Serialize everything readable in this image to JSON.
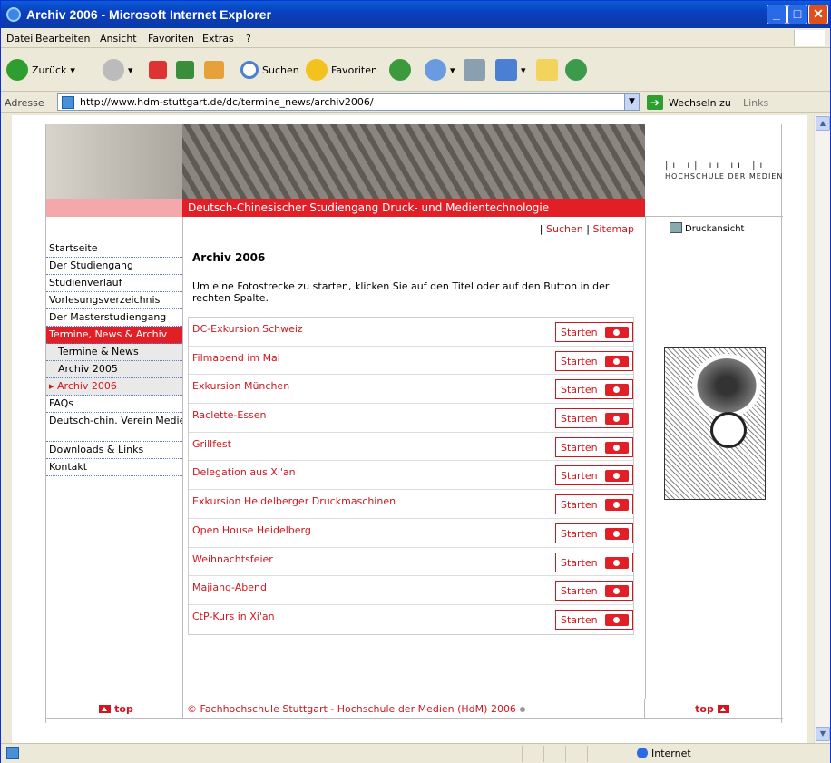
{
  "window": {
    "title": "Archiv 2006 - Microsoft Internet Explorer"
  },
  "menu": [
    "Datei",
    "Bearbeiten",
    "Ansicht",
    "Favoriten",
    "Extras",
    "?"
  ],
  "toolbar": {
    "back": "Zurück",
    "search": "Suchen",
    "favorites": "Favoriten"
  },
  "address": {
    "label": "Adresse",
    "url": "http://www.hdm-stuttgart.de/dc/termine_news/archiv2006/",
    "go": "Wechseln zu",
    "links": "Links"
  },
  "site": {
    "banner_title": "Deutsch-Chinesischer Studiengang Druck- und Medientechnologie",
    "logo_text": "HOCHSCHULE DER MEDIEN",
    "topnav": {
      "search": "Suchen",
      "sitemap": "Sitemap",
      "sep": "|"
    },
    "print": "Druckansicht",
    "nav": [
      {
        "label": "Startseite"
      },
      {
        "label": "Der Studiengang"
      },
      {
        "label": "Studienverlauf"
      },
      {
        "label": "Vorlesungsverzeichnis"
      },
      {
        "label": "Der Masterstudiengang"
      },
      {
        "label": "Termine, News & Archiv"
      },
      {
        "label": "Termine & News"
      },
      {
        "label": "Archiv 2005"
      },
      {
        "label": "▸ Archiv 2006"
      },
      {
        "label": "FAQs"
      },
      {
        "label": "Deutsch-chin. Verein Medientechnologie"
      },
      {
        "label": "Downloads & Links"
      },
      {
        "label": "Kontakt"
      }
    ],
    "heading": "Archiv 2006",
    "intro": "Um eine Fotostrecke zu starten, klicken Sie auf den Titel oder auf den Button in der rechten Spalte.",
    "button_label": "Starten",
    "events": [
      "DC-Exkursion Schweiz",
      "Filmabend im Mai",
      "Exkursion München",
      "Raclette-Essen",
      "Grillfest",
      "Delegation aus Xi'an",
      "Exkursion Heidelberger Druckmaschinen",
      "Open House Heidelberg",
      "Weihnachtsfeier",
      "Majiang-Abend",
      "CtP-Kurs in Xi'an"
    ],
    "footer": {
      "top": "top",
      "copyright": "© Fachhochschule Stuttgart - Hochschule der Medien (HdM) 2006"
    }
  },
  "status": {
    "zone": "Internet"
  }
}
